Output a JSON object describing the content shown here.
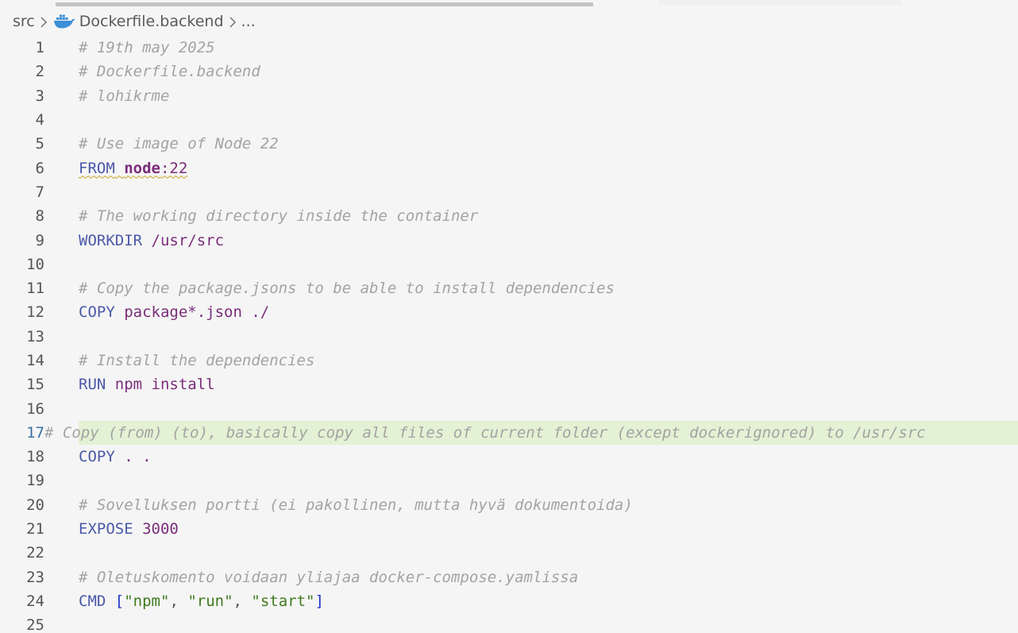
{
  "breadcrumb": {
    "folder": "src",
    "file": "Dockerfile.backend",
    "more": "..."
  },
  "icons": {
    "file_icon": "docker-whale-icon",
    "separator": "chevron-right-icon"
  },
  "colors": {
    "comment": "#a3a3a3",
    "keyword": "#4b59a8",
    "argument": "#7a2d7a",
    "string": "#3f7a1f",
    "active_line_bg": "#e3f1d4"
  },
  "editor": {
    "active_line": 17,
    "lines": [
      {
        "n": "1",
        "tokens": [
          {
            "t": "# 19th may 2025",
            "c": "cm"
          }
        ]
      },
      {
        "n": "2",
        "tokens": [
          {
            "t": "# Dockerfile.backend",
            "c": "cm"
          }
        ]
      },
      {
        "n": "3",
        "tokens": [
          {
            "t": "# lohikrme",
            "c": "cm"
          }
        ]
      },
      {
        "n": "4",
        "tokens": []
      },
      {
        "n": "5",
        "tokens": [
          {
            "t": "# Use image of Node 22",
            "c": "cm"
          }
        ]
      },
      {
        "n": "6",
        "tokens": [
          {
            "t": "FROM",
            "c": "kw",
            "sq": true
          },
          {
            "t": " ",
            "c": "punc",
            "sq": true
          },
          {
            "t": "node",
            "c": "img",
            "sq": true
          },
          {
            "t": ":22",
            "c": "arg",
            "sq": true
          }
        ]
      },
      {
        "n": "7",
        "tokens": []
      },
      {
        "n": "8",
        "tokens": [
          {
            "t": "# The working directory inside the container",
            "c": "cm"
          }
        ]
      },
      {
        "n": "9",
        "tokens": [
          {
            "t": "WORKDIR",
            "c": "kw"
          },
          {
            "t": " /usr/src",
            "c": "arg"
          }
        ]
      },
      {
        "n": "10",
        "tokens": []
      },
      {
        "n": "11",
        "tokens": [
          {
            "t": "# Copy the package.jsons to be able to install dependencies",
            "c": "cm"
          }
        ]
      },
      {
        "n": "12",
        "tokens": [
          {
            "t": "COPY",
            "c": "kw"
          },
          {
            "t": " package*.json ./",
            "c": "arg"
          }
        ]
      },
      {
        "n": "13",
        "tokens": []
      },
      {
        "n": "14",
        "tokens": [
          {
            "t": "# Install the dependencies",
            "c": "cm"
          }
        ]
      },
      {
        "n": "15",
        "tokens": [
          {
            "t": "RUN",
            "c": "kw"
          },
          {
            "t": " npm install",
            "c": "arg"
          }
        ]
      },
      {
        "n": "16",
        "tokens": []
      },
      {
        "n": "17",
        "tokens": [
          {
            "t": "# Copy (from) (to), basically copy all files of current folder (except dockerignored) to /usr/src",
            "c": "cm"
          }
        ]
      },
      {
        "n": "18",
        "tokens": [
          {
            "t": "COPY",
            "c": "kw"
          },
          {
            "t": " . .",
            "c": "arg"
          }
        ]
      },
      {
        "n": "19",
        "tokens": []
      },
      {
        "n": "20",
        "tokens": [
          {
            "t": "# Sovelluksen portti (ei pakollinen, mutta hyvä dokumentoida)",
            "c": "cm"
          }
        ]
      },
      {
        "n": "21",
        "tokens": [
          {
            "t": "EXPOSE",
            "c": "kw"
          },
          {
            "t": " 3000",
            "c": "arg"
          }
        ]
      },
      {
        "n": "22",
        "tokens": []
      },
      {
        "n": "23",
        "tokens": [
          {
            "t": "# Oletuskomento voidaan yliajaa docker-compose.yamlissa",
            "c": "cm"
          }
        ]
      },
      {
        "n": "24",
        "tokens": [
          {
            "t": "CMD",
            "c": "kw"
          },
          {
            "t": " ",
            "c": "punc"
          },
          {
            "t": "[",
            "c": "br"
          },
          {
            "t": "\"npm\"",
            "c": "str"
          },
          {
            "t": ", ",
            "c": "punc"
          },
          {
            "t": "\"run\"",
            "c": "str"
          },
          {
            "t": ", ",
            "c": "punc"
          },
          {
            "t": "\"start\"",
            "c": "str"
          },
          {
            "t": "]",
            "c": "br"
          }
        ]
      },
      {
        "n": "25",
        "tokens": []
      }
    ]
  }
}
